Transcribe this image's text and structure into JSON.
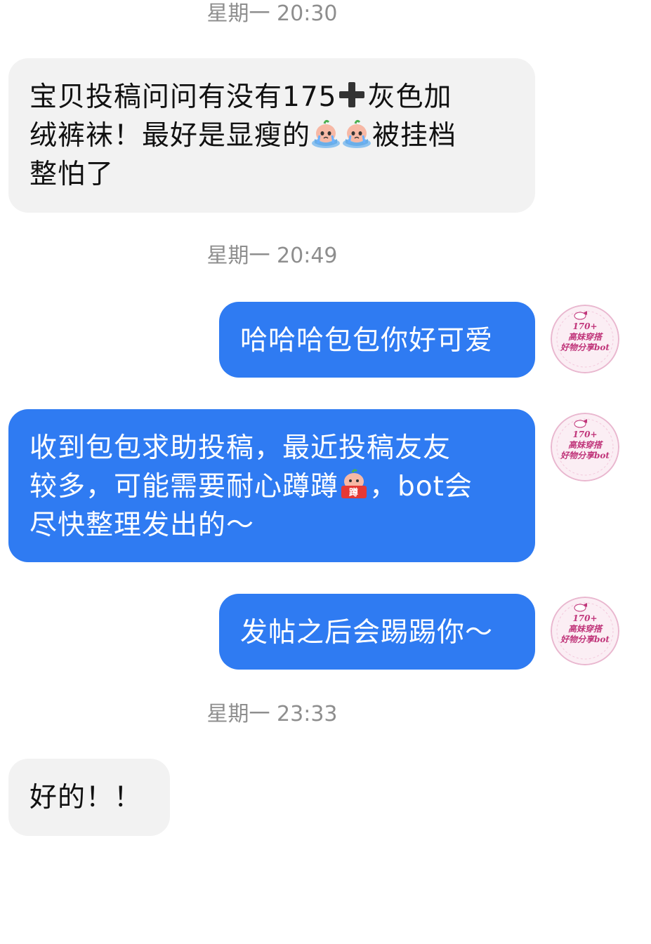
{
  "timestamps": [
    "星期一 20:30",
    "星期一 20:49",
    "星期一 23:33"
  ],
  "messages": [
    {
      "from": "other",
      "parts": [
        "宝贝投稿问问有没有175",
        "灰色加",
        "绒裤袜！最好是显瘦的",
        "被挂档",
        "整怕了"
      ],
      "emoji": [
        "heavy-plus-icon",
        "crying-peach-emoji",
        "crying-peach-emoji"
      ]
    },
    {
      "from": "me",
      "text": "哈哈哈包包你好可爱"
    },
    {
      "from": "me",
      "parts": [
        "收到包包求助投稿，最近投稿友友",
        "较多，可能需要耐心蹲蹲",
        "，bot会",
        "尽快整理发出的～"
      ],
      "emoji": [
        "peach-dun-sign-emoji"
      ]
    },
    {
      "from": "me",
      "text": "发帖之后会踢踢你～"
    },
    {
      "from": "other",
      "text": "好的！！"
    }
  ],
  "avatar": {
    "text": "170+\n高妹穿搭\n好物分享bot",
    "border_color": "#e9b7cf",
    "bg_color": "#fbeef4"
  },
  "colors": {
    "outgoing_bubble": "#2f7bf2",
    "incoming_bubble": "#f2f2f2",
    "timestamp": "#8e8e8e"
  }
}
